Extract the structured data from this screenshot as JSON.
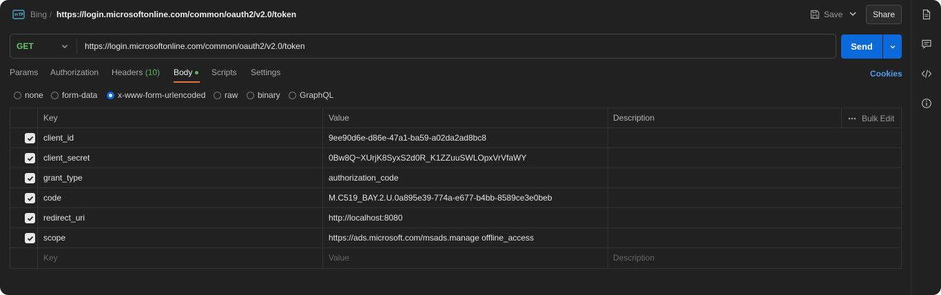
{
  "header": {
    "breadcrumb_parent": "Bing",
    "breadcrumb_sep": "/",
    "request_title": "https://login.microsoftonline.com/common/oauth2/v2.0/token",
    "save_label": "Save",
    "share_label": "Share"
  },
  "url_bar": {
    "method": "GET",
    "url": "https://login.microsoftonline.com/common/oauth2/v2.0/token",
    "send_label": "Send"
  },
  "tabs": {
    "params": "Params",
    "authorization": "Authorization",
    "headers": "Headers",
    "headers_count": "(10)",
    "body": "Body",
    "scripts": "Scripts",
    "settings": "Settings",
    "active": "Body",
    "cookies": "Cookies"
  },
  "body_types": {
    "options": [
      "none",
      "form-data",
      "x-www-form-urlencoded",
      "raw",
      "binary",
      "GraphQL"
    ],
    "selected": "x-www-form-urlencoded"
  },
  "table": {
    "headers": {
      "key": "Key",
      "value": "Value",
      "description": "Description",
      "bulk_edit": "Bulk Edit"
    },
    "rows": [
      {
        "key": "client_id",
        "value": "9ee90d6e-d86e-47a1-ba59-a02da2ad8bc8",
        "description": "",
        "checked": true
      },
      {
        "key": "client_secret",
        "value": "0Bw8Q~XUrjK8SyxS2d0R_K1ZZuuSWLOpxVrVfaWY",
        "description": "",
        "checked": true
      },
      {
        "key": "grant_type",
        "value": "authorization_code",
        "description": "",
        "checked": true
      },
      {
        "key": "code",
        "value": "M.C519_BAY.2.U.0a895e39-774a-e677-b4bb-8589ce3e0beb",
        "description": "",
        "checked": true
      },
      {
        "key": "redirect_uri",
        "value": "http://localhost:8080",
        "description": "",
        "checked": true
      },
      {
        "key": "scope",
        "value": "https://ads.microsoft.com/msads.manage offline_access",
        "description": "",
        "checked": true
      }
    ],
    "placeholder": {
      "key": "Key",
      "value": "Value",
      "description": "Description"
    }
  },
  "colors": {
    "background": "#212121",
    "accent_blue": "#0b69d9",
    "method_green": "#6ac46a",
    "tab_underline": "#e8743b",
    "cookies_link": "#4d9ef2"
  },
  "icons": {
    "request_type": "http-request-icon",
    "save": "floppy-disk-icon",
    "right_bar": [
      "document-icon",
      "comment-icon",
      "code-icon",
      "info-icon"
    ]
  }
}
